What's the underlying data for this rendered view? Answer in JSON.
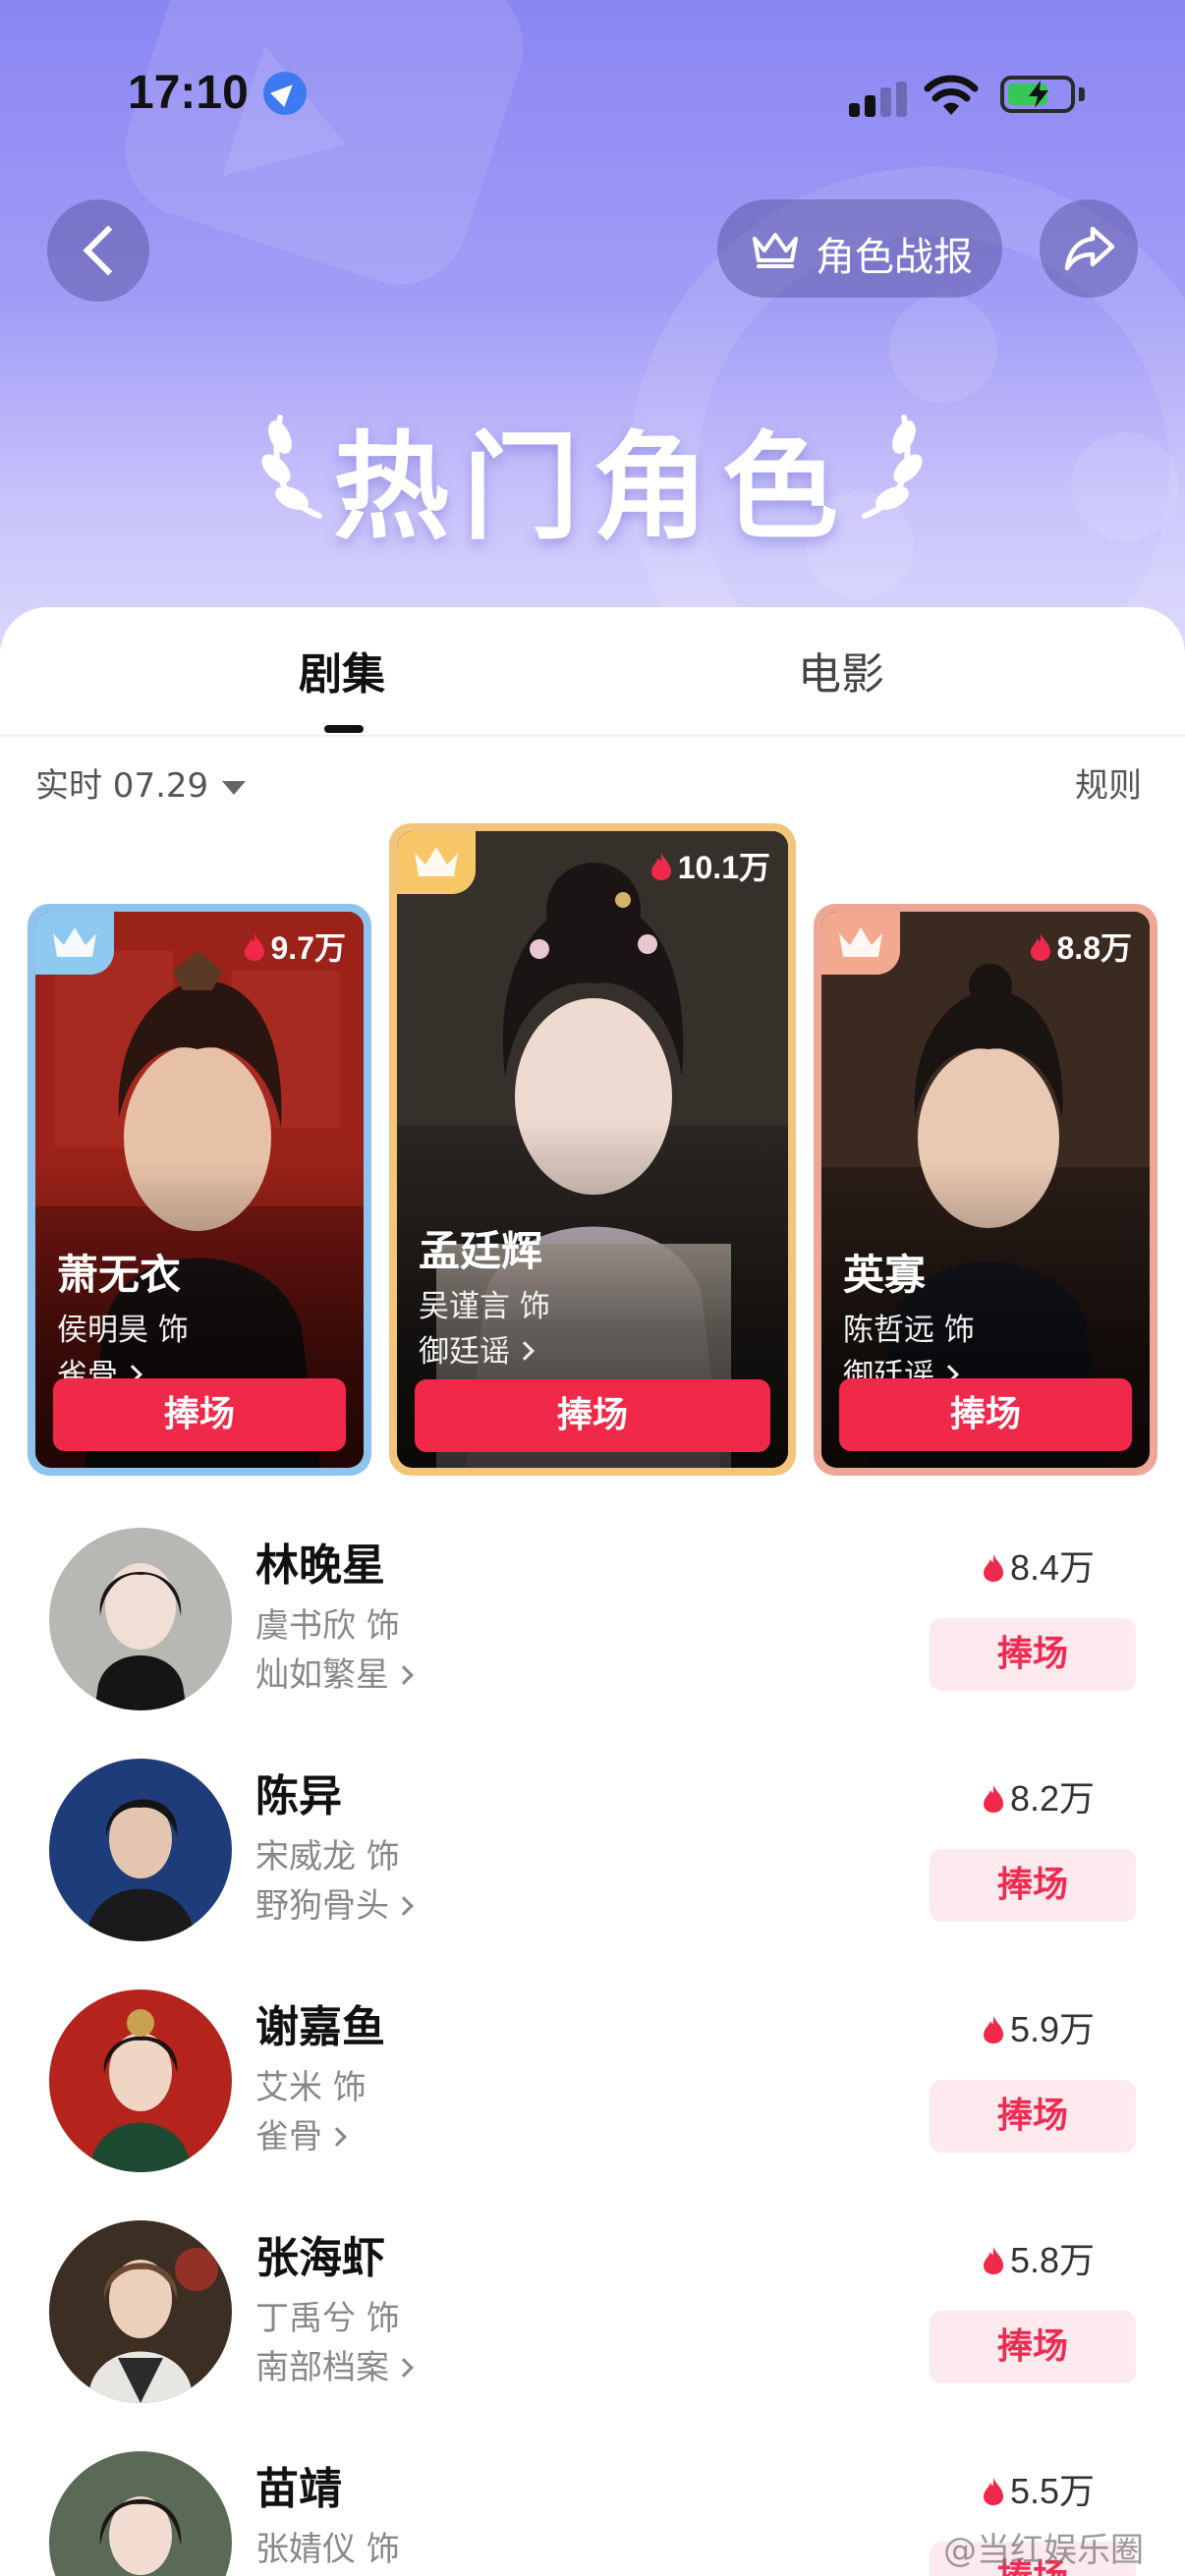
{
  "status_bar": {
    "time": "17:10"
  },
  "header": {
    "battle_report_label": "角色战报",
    "hero_title": "热门角色"
  },
  "tabs": [
    {
      "label": "剧集",
      "active": true
    },
    {
      "label": "电影",
      "active": false
    }
  ],
  "filter": {
    "date_label": "实时 07.29",
    "rules_label": "规则"
  },
  "top_cards": [
    {
      "rank": 2,
      "heat": "9.7万",
      "name": "萧无衣",
      "actor": "侯明昊 饰",
      "show": "雀骨",
      "button": "捧场",
      "frame_color": "#8ec3ee",
      "badge_color": "#8ec9f0"
    },
    {
      "rank": 1,
      "heat": "10.1万",
      "name": "孟廷辉",
      "actor": "吴谨言 饰",
      "show": "御廷谣",
      "button": "捧场",
      "frame_color": "#f3c57a",
      "badge_color": "#f6c667"
    },
    {
      "rank": 3,
      "heat": "8.8万",
      "name": "英寡",
      "actor": "陈哲远 饰",
      "show": "御廷谣",
      "button": "捧场",
      "frame_color": "#eea697",
      "badge_color": "#f2a98f"
    }
  ],
  "list": [
    {
      "name": "林晚星",
      "actor": "虞书欣 饰",
      "show": "灿如繁星",
      "heat": "8.4万",
      "button": "捧场"
    },
    {
      "name": "陈异",
      "actor": "宋威龙 饰",
      "show": "野狗骨头",
      "heat": "8.2万",
      "button": "捧场"
    },
    {
      "name": "谢嘉鱼",
      "actor": "艾米 饰",
      "show": "雀骨",
      "heat": "5.9万",
      "button": "捧场"
    },
    {
      "name": "张海虾",
      "actor": "丁禹兮 饰",
      "show": "南部档案",
      "heat": "5.8万",
      "button": "捧场"
    },
    {
      "name": "苗靖",
      "actor": "张婧仪 饰",
      "show": "",
      "heat": "5.5万",
      "button": "捧场"
    }
  ],
  "watermark": "@当红娱乐圈",
  "colors": {
    "accent": "#f0284a",
    "header": "#8a86f2",
    "button_soft": "#fdeaef"
  }
}
